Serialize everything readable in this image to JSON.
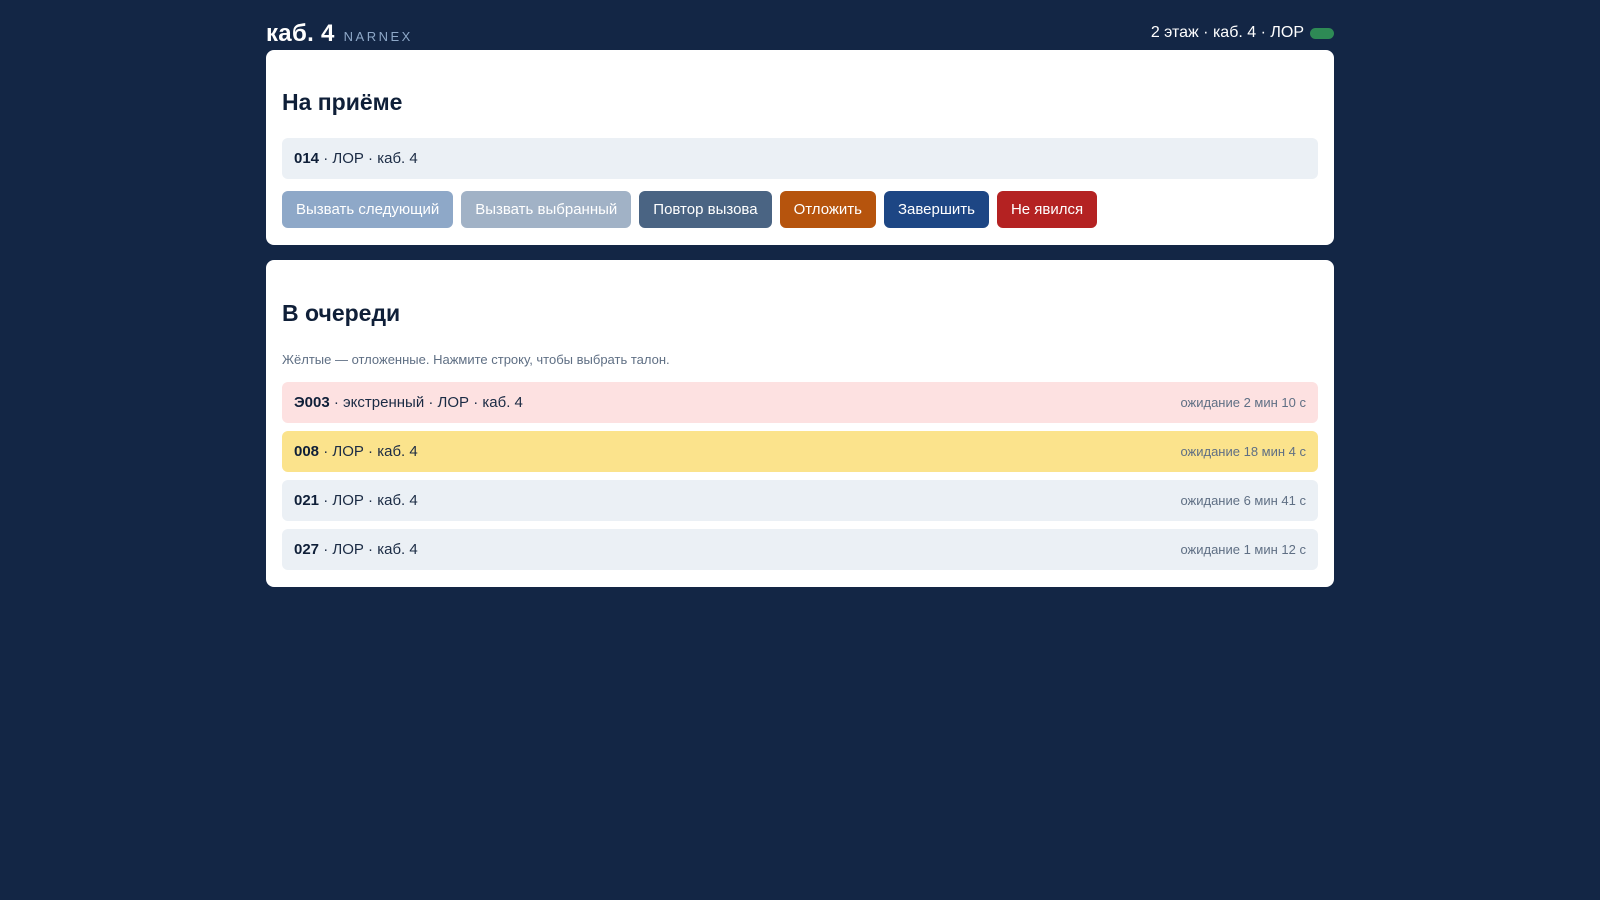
{
  "header": {
    "title": "каб. 4",
    "brand": "NARNEX",
    "location": "2 этаж · каб. 4 · ЛОР"
  },
  "current": {
    "title": "На приёме",
    "ticket": "014",
    "details": " · ЛОР · каб. 4",
    "buttons": {
      "call_next": "Вызвать следующий",
      "call_selected": "Вызвать выбранный",
      "repeat_call": "Повтор вызова",
      "defer": "Отложить",
      "finish": "Завершить",
      "no_show": "Не явился"
    }
  },
  "queue": {
    "title": "В очереди",
    "hint": "Жёлтые — отложенные. Нажмите строку, чтобы выбрать талон.",
    "items": [
      {
        "ticket": "Э003",
        "details": " · экстренный · ЛОР · каб. 4",
        "wait": "ожидание 2 мин 10 с",
        "state": "urgent"
      },
      {
        "ticket": "008",
        "details": " · ЛОР · каб. 4",
        "wait": "ожидание 18 мин 4 с",
        "state": "deferred"
      },
      {
        "ticket": "021",
        "details": " · ЛОР · каб. 4",
        "wait": "ожидание 6 мин 41 с",
        "state": "normal"
      },
      {
        "ticket": "027",
        "details": " · ЛОР · каб. 4",
        "wait": "ожидание 1 мин 12 с",
        "state": "normal"
      }
    ]
  },
  "colors": {
    "background": "#132645",
    "status_online": "#2e8a55",
    "urgent_row": "#fde1e1",
    "deferred_row": "#fbe38c",
    "normal_row": "#ebf0f5"
  }
}
